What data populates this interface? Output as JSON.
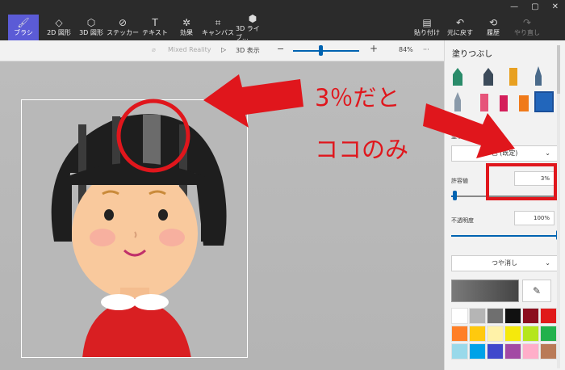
{
  "toolbar": {
    "tools": [
      {
        "label": "ブラシ",
        "icon": "brush-icon",
        "glyph": "🖌"
      },
      {
        "label": "2D 図形",
        "icon": "shapes-2d-icon",
        "glyph": "◇"
      },
      {
        "label": "3D 図形",
        "icon": "shapes-3d-icon",
        "glyph": "⬡"
      },
      {
        "label": "ステッカー",
        "icon": "sticker-icon",
        "glyph": "⊘"
      },
      {
        "label": "テキスト",
        "icon": "text-icon",
        "glyph": "T"
      },
      {
        "label": "効果",
        "icon": "effects-icon",
        "glyph": "✲"
      },
      {
        "label": "キャンバス",
        "icon": "canvas-icon",
        "glyph": "⌗"
      },
      {
        "label": "3D ライブ...",
        "icon": "library-3d-icon",
        "glyph": "⬢"
      }
    ],
    "right": [
      {
        "label": "貼り付け",
        "icon": "paste-icon",
        "glyph": "📋"
      },
      {
        "label": "元に戻す",
        "icon": "undo-icon",
        "glyph": "↶"
      },
      {
        "label": "履歴",
        "icon": "history-icon",
        "glyph": "⟲"
      },
      {
        "label": "やり直し",
        "icon": "redo-icon",
        "glyph": "↷"
      }
    ]
  },
  "subbar": {
    "mixed_reality": "Mixed Reality",
    "view_3d": "3D 表示",
    "zoom_minus": "−",
    "zoom_plus": "+",
    "zoom_value": "84%",
    "more": "···"
  },
  "panel": {
    "title": "塗りつぶし",
    "type_label": "塗りつ",
    "color_select": "色 (既定)",
    "tolerance_label": "許容値",
    "tolerance_value": "3%",
    "opacity_label": "不透明度",
    "opacity_value": "100%",
    "finish_select": "つや消し",
    "tolerance_level": 0.03,
    "opacity_level": 1.0,
    "swatches": [
      "#ffffff",
      "#b5b5b5",
      "#6f6f6f",
      "#111111",
      "#8b0e1e",
      "#e01a1a",
      "#ff7f27",
      "#ffc90e",
      "#fff2a8",
      "#f5e90c",
      "#b5e61d",
      "#22b14c",
      "#99d9ea",
      "#00a2e8",
      "#3f48cc",
      "#a349a4",
      "#ffaec9",
      "#b97a57"
    ]
  },
  "annotation": {
    "line1": "3％だと",
    "line2": "ココのみ",
    "color": "#e0161c"
  }
}
